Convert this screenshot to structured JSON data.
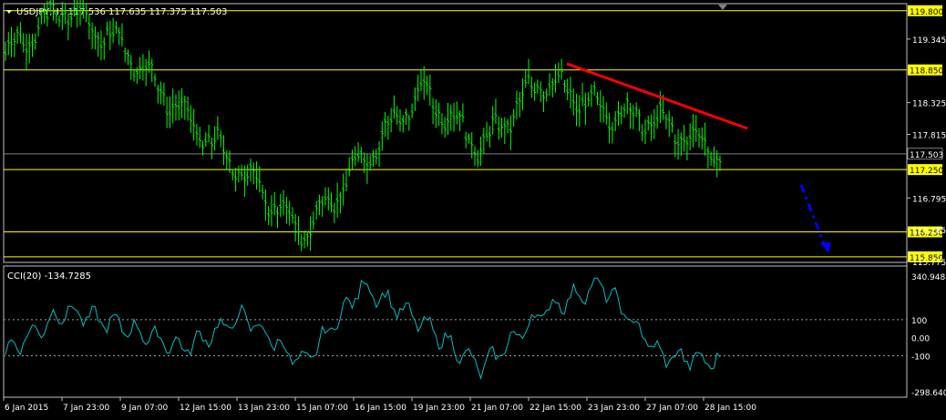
{
  "main_chart": {
    "header": "USDJPY,H1  117.536 117.635 117.375 117.503",
    "price_ticks": [
      "119.345",
      "118.325",
      "117.815",
      "116.795",
      "116.285",
      "115.775"
    ],
    "hlines": [
      {
        "price": 119.8,
        "label": "119.800"
      },
      {
        "price": 118.85,
        "label": "118.850"
      },
      {
        "price": 117.25,
        "label": "117.250"
      },
      {
        "price": 116.25,
        "label": "116.250"
      },
      {
        "price": 115.85,
        "label": "115.850"
      }
    ],
    "current_price": {
      "price": 117.503,
      "label": "117.503"
    },
    "trendline_color": "#ff0000",
    "arrow_color": "#0000ff",
    "bar_color": "#00ff00",
    "level_color": "#ffff00"
  },
  "indicator": {
    "header": "CCI(20) -134.7285",
    "ticks": [
      "340.9486",
      "100",
      "0.00",
      "-100",
      "-298.6405"
    ],
    "line_color": "#00c0c0"
  },
  "time_axis": {
    "labels": [
      "6 Jan 2015",
      "7 Jan 23:00",
      "9 Jan 07:00",
      "12 Jan 15:00",
      "13 Jan 23:00",
      "15 Jan 07:00",
      "16 Jan 15:00",
      "19 Jan 23:00",
      "21 Jan 07:00",
      "22 Jan 15:00",
      "23 Jan 23:00",
      "27 Jan 07:00",
      "28 Jan 15:00"
    ]
  },
  "chart_data": {
    "type": "line",
    "title": "USDJPY,H1",
    "series": [
      {
        "name": "USDJPY,H1",
        "x": [
          "6 Jan 2015",
          "7 Jan 23:00",
          "9 Jan 07:00",
          "12 Jan 15:00",
          "13 Jan 23:00",
          "15 Jan 07:00",
          "16 Jan 15:00",
          "19 Jan 23:00",
          "21 Jan 07:00",
          "22 Jan 15:00",
          "23 Jan 23:00",
          "27 Jan 07:00",
          "28 Jan 15:00"
        ],
        "values": [
          119.1,
          119.85,
          119.2,
          118.1,
          117.2,
          116.2,
          117.4,
          118.5,
          117.6,
          118.7,
          118.2,
          118.0,
          117.5
        ]
      },
      {
        "name": "CCI(20)",
        "x": [
          "6 Jan 2015",
          "7 Jan 23:00",
          "9 Jan 07:00",
          "12 Jan 15:00",
          "13 Jan 23:00",
          "15 Jan 07:00",
          "16 Jan 15:00",
          "19 Jan 23:00",
          "21 Jan 07:00",
          "22 Jan 15:00",
          "23 Jan 23:00",
          "27 Jan 07:00",
          "28 Jan 15:00"
        ],
        "values": [
          -80,
          150,
          60,
          -60,
          120,
          -150,
          290,
          80,
          -170,
          140,
          300,
          -100,
          -135
        ]
      }
    ],
    "ylim": [
      115.775,
      119.855
    ]
  }
}
